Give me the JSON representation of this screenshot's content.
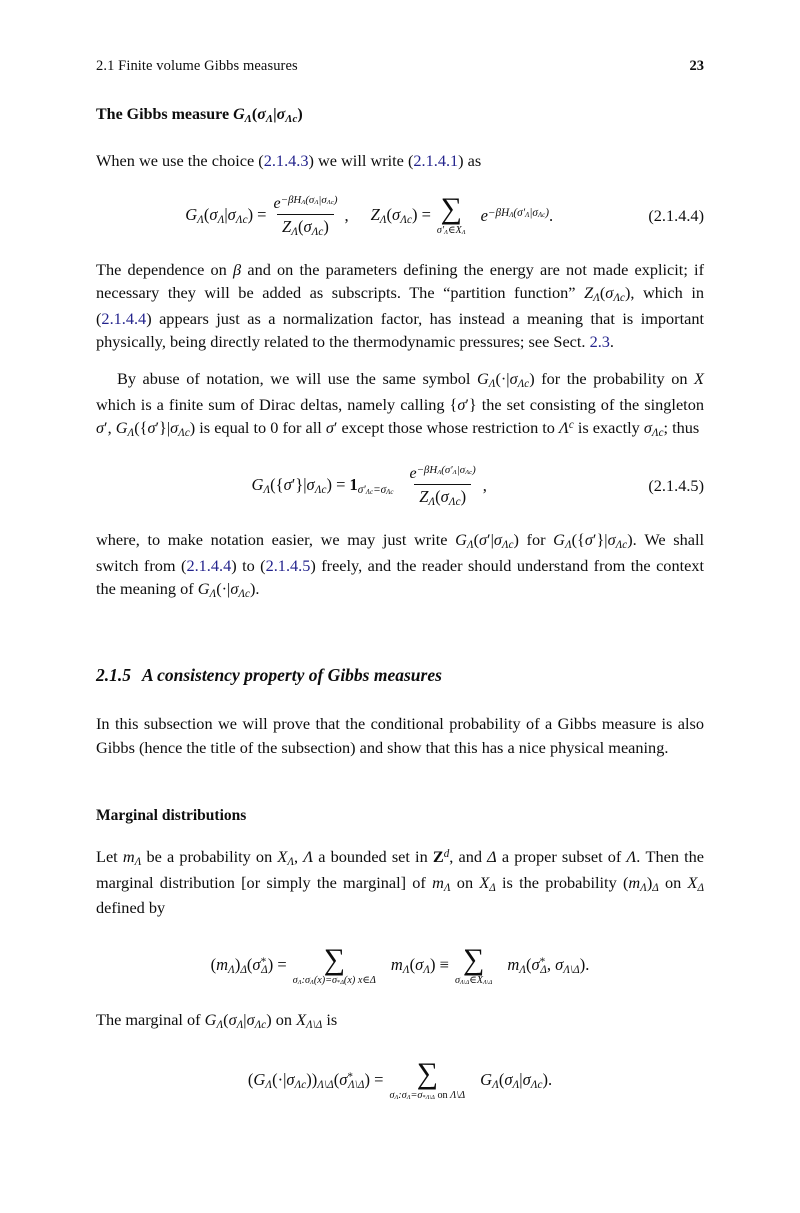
{
  "page": {
    "running_head": "2.1 Finite volume Gibbs measures",
    "page_number": "23",
    "ref_color": "#23238c"
  },
  "headings": {
    "gibbs_measure": "The Gibbs measure GΛ(σΛ|σΛc)",
    "subsection_number": "2.1.5",
    "subsection_title": "A consistency property of Gibbs measures",
    "marginal_distributions": "Marginal distributions"
  },
  "paragraphs": {
    "p1_intro": "When we use the choice (2.1.4.3) we will write (2.1.4.1) as",
    "p1_ref_a": "2.1.4.3",
    "p1_ref_b": "2.1.4.1",
    "p2_a": "The dependence on β and on the parameters defining the energy are not made explicit; if necessary they will be added as subscripts. The “partition function” ZΛ(σΛc), which in (2.1.4.4) appears just as a normalization factor, has instead a meaning that is important physically, being directly related to the thermodynamic pressures; see Sect. 2.3.",
    "p2_ref_eq": "2.1.4.4",
    "p2_ref_sect": "2.3",
    "p3": "By abuse of notation, we will use the same symbol GΛ(·|σΛc) for the probability on 𝐳 which is a finite sum of Dirac deltas, namely calling {σ′} the set consisting of the singleton σ′, GΛ({σ′}|σΛc) is equal to 0 for all σ′ except those whose restriction to Λc is exactly σΛc; thus",
    "p4": "where, to make notation easier, we may just write GΛ(σ′|σΛc) for GΛ({σ′}|σΛc). We shall switch from (2.1.4.4) to (2.1.4.5) freely, and the reader should understand from the context the meaning of GΛ(·|σΛc).",
    "p4_ref_a": "2.1.4.4",
    "p4_ref_b": "2.1.4.5",
    "p5": "In this subsection we will prove that the conditional probability of a Gibbs measure is also Gibbs (hence the title of the subsection) and show that this has a nice physical meaning.",
    "p6": "Let mΛ be a probability on 𝐳Λ, Λ a bounded set in ℤd, and Δ a proper subset of Λ. Then the marginal distribution [or simply the marginal] of mΛ on 𝐳Δ is the probability (mΛ)Δ on 𝐳Δ defined by",
    "p7": "The marginal of GΛ(σΛ|σΛc) on 𝐳Λ\\Δ is"
  },
  "equations": {
    "eq_2144": {
      "tag": "(2.1.4.4)",
      "latex": "G_Λ(σ_Λ|σ_{Λ^c}) = e^{-βH_Λ(σ_Λ|σ_{Λ^c})}/Z_Λ(σ_{Λ^c}),  Z_Λ(σ_{Λ^c}) = ∑_{σ′_Λ∈𝐳_Λ} e^{-βH_Λ(σ′_Λ|σ_{Λ^c})}."
    },
    "eq_2145": {
      "tag": "(2.1.4.5)",
      "latex": "G_Λ({σ′}|σ_{Λ^c}) = 𝟏_{σ′_{Λ^c}=σ_{Λ^c}} e^{-βH_Λ(σ′_Λ|σ_{Λ^c})}/Z_Λ(σ_{Λ^c}),"
    },
    "eq_marginal": {
      "tag": "",
      "latex": "(m_Λ)_Δ(σ*_Δ) = ∑_{σ_Λ:σ_Λ(x)=σ*_Δ(x) x∈Δ} m_Λ(σ_Λ) ≡ ∑_{σ_{Λ\\Δ}∈𝐳_{Λ\\Δ}} m_Λ(σ*_Δ,σ_{Λ\\Δ})."
    },
    "eq_marginal_gibbs": {
      "tag": "",
      "latex": "(G_Λ(·|σ_{Λ^c}))_{Λ\\Δ}(σ*_{Λ\\Δ}) = ∑_{σ_Λ:σ_Λ=σ*_{Λ\\Δ} on Λ\\Δ} G_Λ(σ_Λ|σ_{Λ^c})."
    }
  },
  "tags": {
    "eq_2144": "(2.1.4.4)",
    "eq_2145": "(2.1.4.5)"
  },
  "symbols": {
    "G": "G",
    "Z": "Z",
    "H": "H",
    "m": "m",
    "e": "e",
    "beta": "β",
    "sigma": "σ",
    "Lambda": "Λ",
    "Delta": "Δ",
    "chi": "𝐳",
    "Zd": "ℤ",
    "equiv": "≡",
    "in": "∈",
    "sum": "∑",
    "bold_one": "1",
    "dot": "·",
    "c": "c",
    "d": "d",
    "x": "x",
    "on": "on",
    "star": "*"
  }
}
